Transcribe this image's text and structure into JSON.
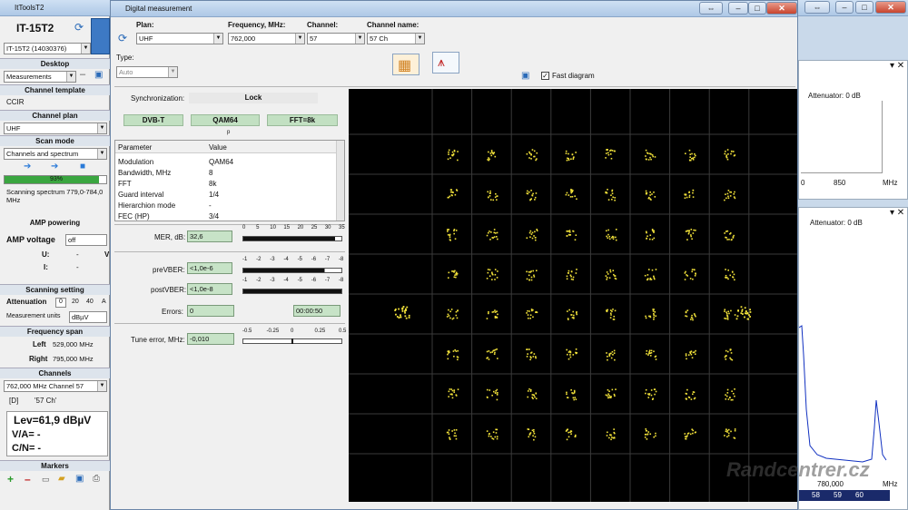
{
  "app": {
    "title": "ItToolsT2"
  },
  "left": {
    "device": "IT-15T2",
    "serial": "IT-15T2 (14030376)",
    "desktop_h": "Desktop",
    "desktop": "Measurements",
    "template_h": "Channel template",
    "template": "CCIR",
    "plan_h": "Channel plan",
    "plan": "UHF",
    "scan_h": "Scan mode",
    "scan": "Channels and spectrum",
    "progress": "93%",
    "progress_value": 0.93,
    "scan_status": "Scanning spectrum 779,0-784,0 MHz",
    "amp_h": "AMP powering",
    "amp_label": "AMP voltage",
    "amp_value": "off",
    "u_label": "U:",
    "u_val": "-",
    "i_label": "I:",
    "i_val": "-",
    "v_label": "V",
    "scanset_h": "Scanning setting",
    "atten_label": "Attenuation",
    "atten_opts": [
      "0",
      "20",
      "40",
      "A"
    ],
    "units_label": "Measurement units",
    "units": "dBµV",
    "span_h": "Frequency span",
    "left_label": "Left",
    "left_val": "529,000 MHz",
    "right_label": "Right",
    "right_val": "795,000 MHz",
    "channels_h": "Channels",
    "channel_sel": "762,000 MHz  Channel 57",
    "chan_d": "[D]",
    "chan_name": "'57 Ch'",
    "lev": "Lev=61,9 dBµV",
    "va": "V/A= -",
    "cn": "C/N= -",
    "markers_h": "Markers"
  },
  "dm": {
    "title": "Digital measurement",
    "plan_l": "Plan:",
    "plan": "UHF",
    "freq_l": "Frequency, MHz:",
    "freq": "762,000",
    "chan_l": "Channel:",
    "chan": "57",
    "name_l": "Channel name:",
    "name": "57 Ch",
    "type_l": "Type:",
    "type": "Auto",
    "fast": "Fast diagram",
    "sync_l": "Synchronization:",
    "sync": "Lock",
    "std": "DVB-T",
    "mod": "QAM64",
    "fft": "FFT=8k",
    "p": "p",
    "param_h": "Parameter",
    "value_h": "Value",
    "params": [
      [
        "Modulation",
        "QAM64"
      ],
      [
        "Bandwidth, MHz",
        "8"
      ],
      [
        "FFT",
        "8k"
      ],
      [
        "Guard interval",
        "1/4"
      ],
      [
        "Hierarchion mode",
        "-"
      ],
      [
        "FEC (HP)",
        "3/4"
      ]
    ],
    "mer_l": "MER, dB:",
    "mer": "32,6",
    "mer_value": 32.6,
    "mer_ticks": [
      "0",
      "5",
      "10",
      "15",
      "20",
      "25",
      "30",
      "35"
    ],
    "prevber_l": "preVBER:",
    "prevber": "<1,0e-6",
    "postvber_l": "postVBER:",
    "postvber": "<1,0e-8",
    "ber_ticks": [
      "-1",
      "-2",
      "-3",
      "-4",
      "-5",
      "-6",
      "-7",
      "-8"
    ],
    "errors_l": "Errors:",
    "errors": "0",
    "time": "00:00:50",
    "tune_l": "Tune error, MHz:",
    "tune": "-0,010",
    "tune_value": -0.01,
    "tune_ticks": [
      "-0.5",
      "-0.25",
      "0",
      "0.25",
      "0.5"
    ]
  },
  "rp": {
    "att1": "Attenuator: 0 dB",
    "ax1a": "0",
    "ax1b": "850",
    "ax1c": "MHz",
    "att2": "Attenuator: 0 dB",
    "ax2a": "780,000",
    "ax2b": "MHz",
    "chans": [
      "58",
      "59",
      "60"
    ]
  },
  "watermark": "Randcentrer.cz"
}
